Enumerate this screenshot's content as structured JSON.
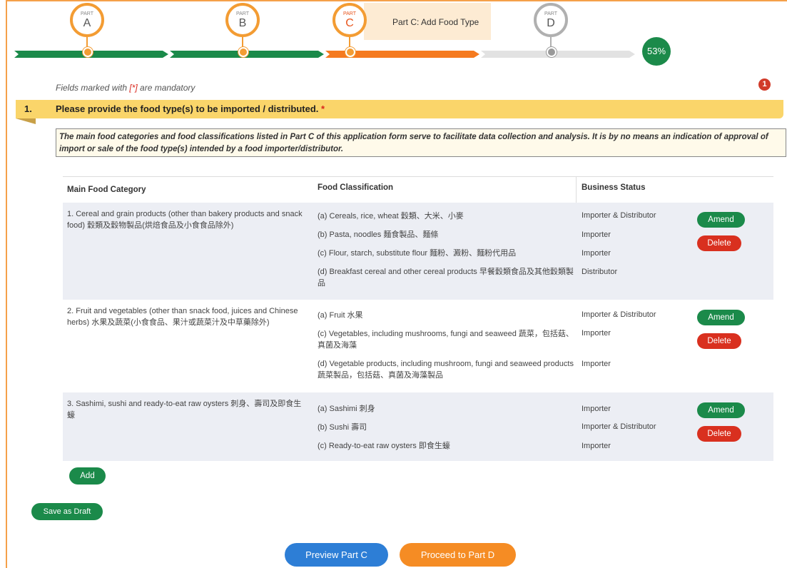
{
  "progress": {
    "parts": [
      {
        "part": "PART",
        "letter": "A",
        "status": "done"
      },
      {
        "part": "PART",
        "letter": "B",
        "status": "done"
      },
      {
        "part": "PART",
        "letter": "C",
        "status": "current"
      },
      {
        "part": "PART",
        "letter": "D",
        "status": "pending"
      }
    ],
    "current_label": "Part C: Add Food Type",
    "percent": "53%",
    "colors": {
      "done": "#1b8a4a",
      "current": "#f57a1f",
      "pending": "#e2e2e2",
      "ring": "#f39c33"
    }
  },
  "mandatory": {
    "prefix": "Fields marked with ",
    "marker": "[*]",
    "suffix": " are mandatory"
  },
  "error_count": "1",
  "question": {
    "number": "1.",
    "text": "Please provide the food type(s) to be imported / distributed. ",
    "required_marker": "*"
  },
  "disclaimer": "The main food categories and food classifications listed in Part C of this application form serve to facilitate data collection and analysis. It is by no means an indication of approval of import or sale of the food type(s) intended by a food importer/distributor.",
  "table": {
    "headers": {
      "category": "Main Food Category",
      "classification": "Food Classification",
      "status": "Business Status"
    },
    "rows": [
      {
        "category": "1. Cereal and grain products (other than bakery products and snack food) 穀類及穀物製品(烘焙食品及小食食品除外)",
        "items": [
          {
            "classification": "(a) Cereals, rice, wheat 穀類、大米、小麥",
            "status": "Importer & Distributor"
          },
          {
            "classification": "(b) Pasta, noodles 麵食製品、麵條",
            "status": "Importer"
          },
          {
            "classification": "(c) Flour, starch, substitute flour 麵粉、澱粉、麵粉代用品",
            "status": "Importer"
          },
          {
            "classification": "(d) Breakfast cereal and other cereal products 早餐穀類食品及其他穀類製品",
            "status": "Distributor"
          }
        ],
        "amend": "Amend",
        "delete": "Delete"
      },
      {
        "category": "2. Fruit and vegetables (other than snack food, juices and Chinese herbs) 水果及蔬菜(小食食品、果汁或蔬菜汁及中草藥除外)",
        "items": [
          {
            "classification": "(a) Fruit 水果",
            "status": "Importer & Distributor"
          },
          {
            "classification": "(c) Vegetables, including mushrooms, fungi and seaweed 蔬菜，包括菇、真菌及海藻",
            "status": "Importer"
          },
          {
            "classification": "(d) Vegetable products, including mushroom, fungi and seaweed products 蔬菜製品，包括菇、真菌及海藻製品",
            "status": "Importer"
          }
        ],
        "amend": "Amend",
        "delete": "Delete"
      },
      {
        "category": "3. Sashimi, sushi and ready-to-eat raw oysters 刺身、壽司及即食生蠔",
        "items": [
          {
            "classification": "(a) Sashimi 刺身",
            "status": "Importer"
          },
          {
            "classification": "(b) Sushi 壽司",
            "status": "Importer & Distributor"
          },
          {
            "classification": "(c) Ready-to-eat raw oysters 即食生蠔",
            "status": "Importer"
          }
        ],
        "amend": "Amend",
        "delete": "Delete"
      }
    ]
  },
  "buttons": {
    "add": "Add",
    "save_draft": "Save as Draft",
    "preview": "Preview Part C",
    "proceed": "Proceed to Part D"
  }
}
